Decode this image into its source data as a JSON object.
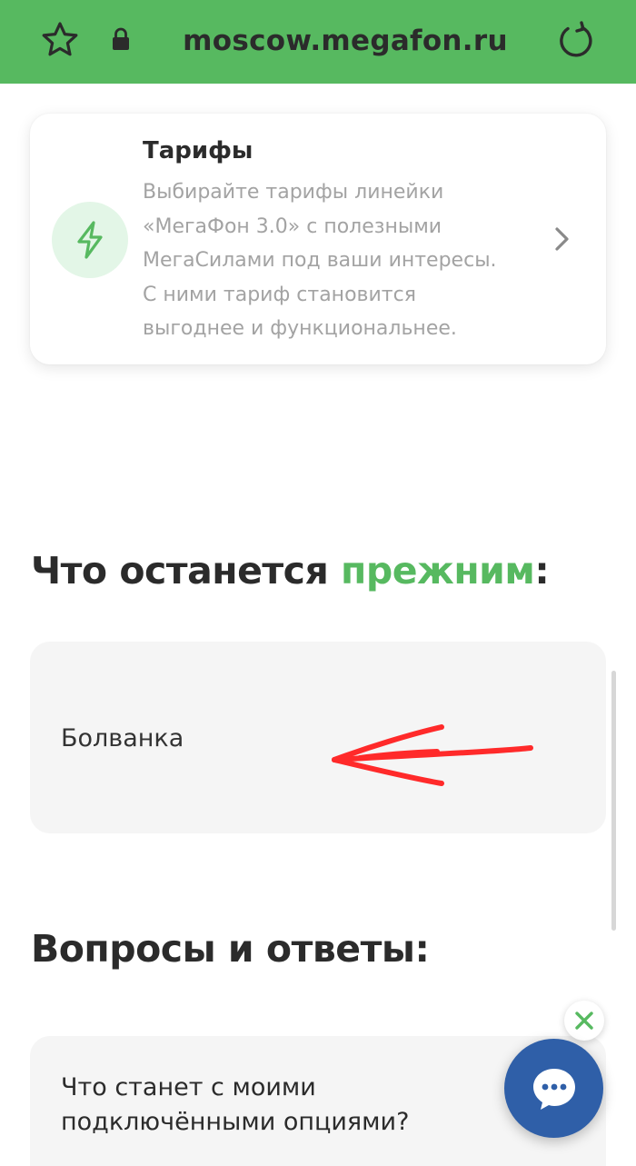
{
  "browser": {
    "url": "moscow.megafon.ru",
    "icons": [
      "star-icon",
      "lock-icon",
      "reload-icon"
    ],
    "accent_color": "#57b960"
  },
  "tariffs_card": {
    "title": "Тарифы",
    "description": "Выбирайте тарифы линейки\n«МегаФон 3.0» с полезными\nМегаСилами под ваши интересы.\nС ними тариф становится\nвыгоднее и функциональнее.",
    "icon": "lightning-icon",
    "chevron_icon": "chevron-right-icon"
  },
  "same_section": {
    "title_prefix": "Что останется ",
    "title_accent": "прежним",
    "title_suffix": ":",
    "item_label": "Болванка"
  },
  "faq_section": {
    "title": "Вопросы и ответы:",
    "questions": [
      {
        "text": "Что станет с моими\nподключёнными опциями?"
      }
    ]
  },
  "chat": {
    "close_icon": "close-icon",
    "chat_icon": "chat-bubble-icon",
    "button_color": "#2f5fa8",
    "close_color": "#57b960"
  },
  "annotation": {
    "arrow_color": "#ff2a2a"
  }
}
